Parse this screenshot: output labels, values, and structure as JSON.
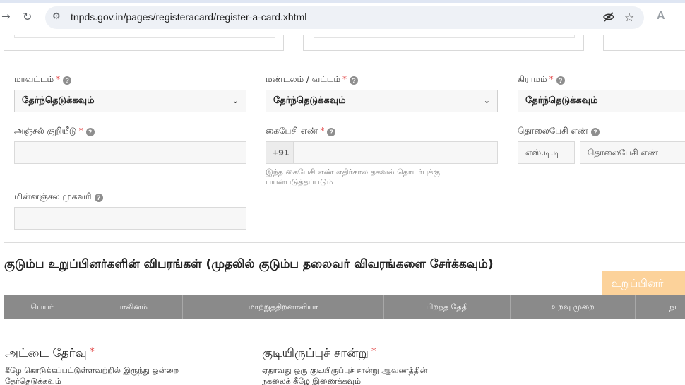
{
  "browser": {
    "url": "tnpds.gov.in/pages/registeracard/register-a-card.xhtml",
    "icons": [
      "back-arrow-icon",
      "reload-icon",
      "site-settings-icon",
      "eye-off-icon",
      "star-icon",
      "extension-icon"
    ]
  },
  "form": {
    "district": {
      "label": "மாவட்டம்",
      "required": "*",
      "help": "?",
      "value": "தேர்ந்தெடுக்கவும்"
    },
    "taluk": {
      "label": "மண்டலம் / வட்டம்",
      "required": "*",
      "help": "?",
      "value": "தேர்ந்தெடுக்கவும்"
    },
    "village": {
      "label": "கிராமம்",
      "required": "*",
      "help": "?",
      "value": "தேர்ந்தெடுக்கவும்"
    },
    "pincode": {
      "label": "அஞ்சல் குறியீடு",
      "required": "*",
      "help": "?",
      "value": ""
    },
    "mobile": {
      "label": "கைபேசி எண்",
      "required": "*",
      "help": "?",
      "prefix": "+91",
      "value": "",
      "hint": "இந்த கைபேசி எண் எதிர்கால தகவல் தொடர்புக்கு பயன்படுத்தப்படும்"
    },
    "landline": {
      "label": "தொலைபேசி எண்",
      "help": "?",
      "std_placeholder": "எஸ்.டி.டி",
      "number_placeholder": "தொலைபேசி எண்"
    },
    "email": {
      "label": "மின்னஞ்சல் முகவரி",
      "help": "?",
      "value": ""
    }
  },
  "members": {
    "title": "குடும்ப உறுப்பினர்களின் விபரங்கள் (முதலில் குடும்ப தலைவர் விவரங்களை சேர்க்கவும்)",
    "add_button": "உறுப்பினர்",
    "columns": [
      "பெயர்",
      "பாலினம்",
      "மாற்றுத்திறனாளியா",
      "பிறந்த தேதி",
      "உறவு முறை",
      "நட"
    ]
  },
  "card_choice": {
    "title": "அட்டை தேர்வு",
    "required": "*",
    "desc_line1": "கீழே கொடுக்கப்பட்டுள்ளவற்றில் இருந்து ஒன்றை",
    "desc_line2": "தேர்தெடுக்கவும்"
  },
  "residence": {
    "title": "குடியிருப்புச் சான்று",
    "required": "*",
    "desc_line1": "ஏதாவது ஒரு குடியிருப்புச் சான்று ஆவணத்தின்",
    "desc_line2": "நகலைக் கீழே இணைக்கவும்"
  },
  "colors": {
    "add_button_bg": "#fcd29a",
    "table_header_bg": "#8a8a8a",
    "required": "#e34b4b"
  }
}
